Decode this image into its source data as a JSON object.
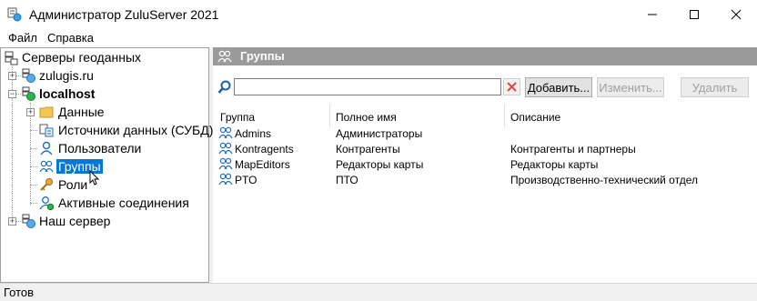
{
  "window": {
    "title": "Администратор ZuluServer 2021"
  },
  "menu": {
    "items": [
      "Файл",
      "Справка"
    ]
  },
  "tree": {
    "root": "Серверы геоданных",
    "items": [
      {
        "label": "zulugis.ru",
        "icon": "server-globe-icon"
      },
      {
        "label": "localhost",
        "icon": "server-online-icon",
        "bold": true
      },
      {
        "label": "Данные",
        "icon": "folder-icon"
      },
      {
        "label": "Источники данных (СУБД)",
        "icon": "datasource-icon"
      },
      {
        "label": "Пользователи",
        "icon": "user-icon"
      },
      {
        "label": "Группы",
        "icon": "group-icon",
        "selected": true
      },
      {
        "label": "Роли",
        "icon": "key-icon"
      },
      {
        "label": "Активные соединения",
        "icon": "connection-icon"
      },
      {
        "label": "Наш сервер",
        "icon": "server-globe-icon"
      }
    ]
  },
  "panel": {
    "header": "Группы",
    "search_value": "",
    "buttons": {
      "add": "Добавить...",
      "edit": "Изменить...",
      "delete": "Удалить"
    },
    "columns": [
      "Группа",
      "Полное имя",
      "Описание"
    ],
    "rows": [
      {
        "name": "Admins",
        "full": "Администраторы",
        "desc": ""
      },
      {
        "name": "Kontragents",
        "full": "Контрагенты",
        "desc": "Контрагенты и партнеры"
      },
      {
        "name": "MapEditors",
        "full": "Редакторы карты",
        "desc": "Редакторы карты"
      },
      {
        "name": "PTO",
        "full": "ПТО",
        "desc": "Производственно-технический отдел"
      }
    ]
  },
  "status": {
    "text": "Готов"
  },
  "colors": {
    "selection": "#0078d7",
    "header": "#9a9a9a",
    "accent": "#1e6fc4"
  }
}
